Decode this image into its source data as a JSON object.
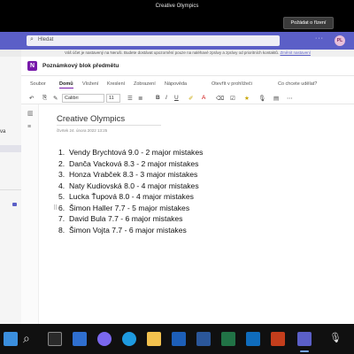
{
  "meeting": {
    "title": "Creative Olympics",
    "request_control": "Požádat o řízení"
  },
  "teams": {
    "search_placeholder": "Hledat",
    "more": "···",
    "avatar_initials": "PL",
    "info_bar_text": "Váš účet je nastavený na Neruši. Budete dostávat upozornění pouze na naléhavé zprávy a zprávy od prioritních kontaktů.",
    "info_bar_link": "Změnit nastavení",
    "left_panel_fragment": "va"
  },
  "notebook": {
    "title": "Poznámkový blok předmětu",
    "tabs": [
      "Soubor",
      "Domů",
      "Vložení",
      "Kreslení",
      "Zobrazení",
      "Nápověda",
      "Otevřít v prohlížeči",
      "Co chcete udělat?"
    ],
    "active_tab": "Domů",
    "font_name": "Calibri",
    "font_size": "11"
  },
  "page": {
    "title": "Creative Olympics",
    "date": "čtvrtek 24. února 2022    13:25",
    "items": [
      {
        "n": "1.",
        "text": "Vendy Brychtová  9.0 - 2 major mistakes"
      },
      {
        "n": "2.",
        "text": "Danča Vacková  8.3 - 2 major mistakes"
      },
      {
        "n": "3.",
        "text": "Honza Vrabček  8.3 - 3 major mistakes"
      },
      {
        "n": "4.",
        "text": "Naty Kudiovská  8.0 - 4 major mistakes"
      },
      {
        "n": "5.",
        "text": "Lucka Ťupová  8.0 - 4 major mistakes"
      },
      {
        "n": "6.",
        "text": "Šimon Haller 7.7 - 5 major mistakes"
      },
      {
        "n": "7.",
        "text": "David Bula 7.7 - 6 major mistakes"
      },
      {
        "n": "8.",
        "text": "Šimon Vojta 7.7 - 6 major mistakes"
      }
    ]
  },
  "colors": {
    "teams_purple": "#5b5fc7",
    "onenote_purple": "#7719aa"
  }
}
